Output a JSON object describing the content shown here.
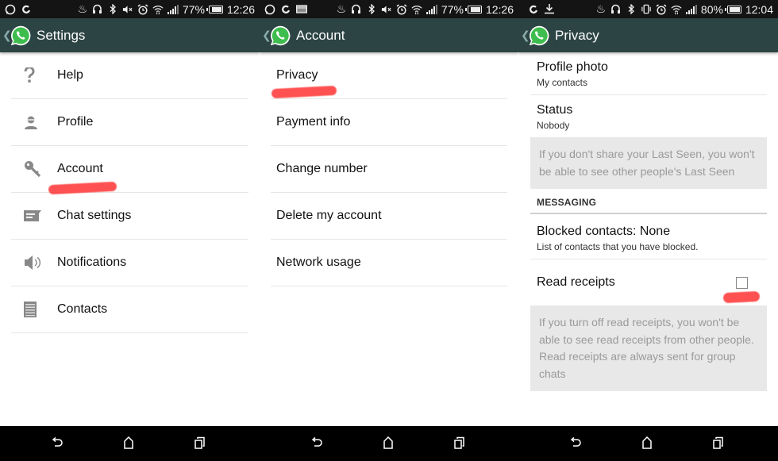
{
  "screens": [
    {
      "status": {
        "battery_percent": "77%",
        "battery_level": 0.77,
        "time": "12:26",
        "left_icons": [
          "whatsapp-notification-icon",
          "sync-icon"
        ],
        "right_icons": [
          "fire-icon",
          "headset-icon",
          "bluetooth-icon",
          "mute-icon",
          "alarm-icon",
          "wifi-icon",
          "signal-icon"
        ]
      },
      "appbar": {
        "title": "Settings",
        "back_icon": "chevron-left-icon",
        "logo": "whatsapp-logo"
      },
      "items": [
        {
          "label": "Help",
          "icon": "help-icon"
        },
        {
          "label": "Profile",
          "icon": "profile-icon"
        },
        {
          "label": "Account",
          "icon": "key-icon",
          "highlighted": true
        },
        {
          "label": "Chat settings",
          "icon": "chat-icon"
        },
        {
          "label": "Notifications",
          "icon": "speaker-icon"
        },
        {
          "label": "Contacts",
          "icon": "contacts-icon"
        }
      ]
    },
    {
      "status": {
        "battery_percent": "77%",
        "battery_level": 0.77,
        "time": "12:26",
        "left_icons": [
          "whatsapp-notification-icon",
          "sync-icon",
          "image-icon"
        ],
        "right_icons": [
          "fire-icon",
          "headset-icon",
          "bluetooth-icon",
          "mute-icon",
          "alarm-icon",
          "wifi-icon",
          "signal-icon"
        ]
      },
      "appbar": {
        "title": "Account",
        "back_icon": "chevron-left-icon",
        "logo": "whatsapp-logo"
      },
      "items": [
        {
          "label": "Privacy",
          "highlighted": true
        },
        {
          "label": "Payment info"
        },
        {
          "label": "Change number"
        },
        {
          "label": "Delete my account"
        },
        {
          "label": "Network usage"
        }
      ]
    },
    {
      "status": {
        "battery_percent": "80%",
        "battery_level": 0.8,
        "time": "12:04",
        "left_icons": [
          "sync-icon",
          "download-icon"
        ],
        "right_icons": [
          "fire-icon",
          "headset-icon",
          "bluetooth-icon",
          "vibrate-icon",
          "alarm-icon",
          "wifi-icon",
          "signal-icon"
        ]
      },
      "appbar": {
        "title": "Privacy",
        "back_icon": "chevron-left-icon",
        "logo": "whatsapp-logo"
      },
      "profile_photo": {
        "title": "Profile photo",
        "value": "My contacts"
      },
      "status_pref": {
        "title": "Status",
        "value": "Nobody"
      },
      "last_seen_note": "If you don't share your Last Seen, you won't be able to see other people's Last Seen",
      "section_messaging": "MESSAGING",
      "blocked": {
        "title": "Blocked contacts: None",
        "value": "List of contacts that you have blocked."
      },
      "read_receipts": {
        "title": "Read receipts",
        "checked": false,
        "highlighted": true
      },
      "read_receipts_note": "If you turn off read receipts, you won't be able to see read receipts from other people. Read receipts are always sent for group chats"
    }
  ],
  "navbar": {
    "buttons": [
      "back-icon",
      "home-icon",
      "recent-apps-icon"
    ]
  },
  "colors": {
    "appbar": "#2d4444",
    "statusbar": "#141414",
    "whatsapp_green": "#3ebd4e",
    "highlight_scribble": "#ff3333",
    "note_bg": "#e8e8e8"
  }
}
